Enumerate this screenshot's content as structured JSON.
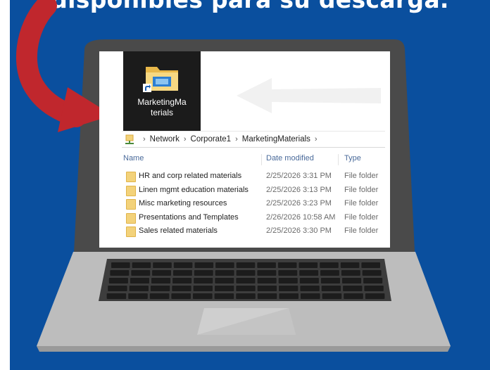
{
  "headline": "disponibles para su descarga.",
  "colors": {
    "background": "#0a4f9e",
    "arrow": "#c0272d",
    "laptop_body": "#b9b9b9",
    "laptop_bezel": "#4a4a4a",
    "folder": "#f3d27a"
  },
  "shortcut": {
    "icon": "folder-shortcut-icon",
    "label_line1": "MarketingMa",
    "label_line2": "terials"
  },
  "breadcrumb": {
    "icon": "network-icon",
    "items": [
      "Network",
      "Corporate1",
      "MarketingMaterials"
    ]
  },
  "columns": {
    "name": "Name",
    "date": "Date modified",
    "type": "Type"
  },
  "files": [
    {
      "name": "HR and corp related materials",
      "date": "2/25/2026 3:31 PM",
      "type": "File folder"
    },
    {
      "name": "Linen mgmt education materials",
      "date": "2/25/2026 3:13 PM",
      "type": "File folder"
    },
    {
      "name": "Misc marketing resources",
      "date": "2/25/2026 3:23 PM",
      "type": "File folder"
    },
    {
      "name": "Presentations and Templates",
      "date": "2/26/2026 10:58 AM",
      "type": "File folder"
    },
    {
      "name": "Sales related materials",
      "date": "2/25/2026 3:30 PM",
      "type": "File folder"
    }
  ]
}
